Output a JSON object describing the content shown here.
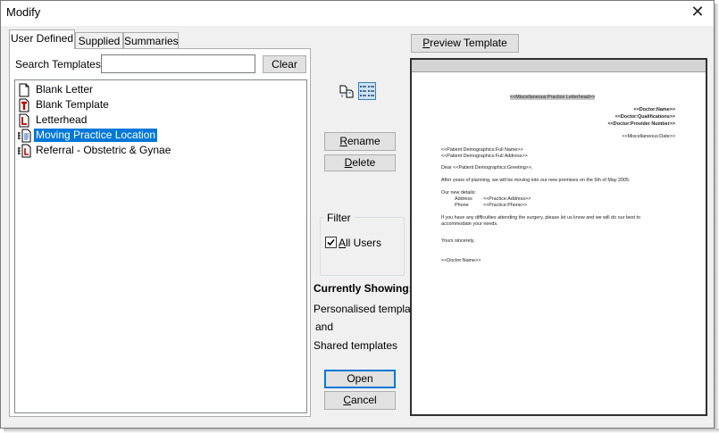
{
  "window": {
    "title": "Modify",
    "close_glyph": "✕"
  },
  "tabs": [
    {
      "label": "User Defined",
      "active": true
    },
    {
      "label": "Supplied",
      "active": false
    },
    {
      "label": "Summaries",
      "active": false
    }
  ],
  "search": {
    "label": "Search Templates:",
    "value": "",
    "clear_label": "Clear"
  },
  "templates": [
    {
      "label": "Blank Letter",
      "icon": "blank-document-icon",
      "selected": false
    },
    {
      "label": "Blank Template",
      "icon": "template-t-icon",
      "selected": false
    },
    {
      "label": "Letterhead",
      "icon": "letterhead-l-icon",
      "selected": false
    },
    {
      "label": "Moving Practice Location",
      "icon": "shared-document-icon",
      "selected": true
    },
    {
      "label": "Referral - Obstetric & Gynae",
      "icon": "shared-document-icon",
      "selected": false
    }
  ],
  "toolbar": {
    "small_icons": "small-icons-view-icon",
    "list_view": "list-view-icon"
  },
  "actions": {
    "rename_prefix": "R",
    "rename_rest": "ename",
    "delete_prefix": "D",
    "delete_rest": "elete",
    "open_label": "Open",
    "cancel_prefix": "C",
    "cancel_rest": "ancel"
  },
  "filter": {
    "title": "Filter",
    "all_users_prefix": "A",
    "all_users_rest": "ll Users",
    "all_users_checked": true
  },
  "showing": {
    "heading": "Currently Showing:",
    "line1": "Personalised templates",
    "line2": "and",
    "line3": "Shared templates"
  },
  "preview": {
    "button_prefix": "P",
    "button_rest": "review Template",
    "doc": {
      "letterhead": "<<Miscellaneous:Practice Letterhead>>",
      "doctor_name": "<<Doctor:Name>>",
      "doctor_quals": "<<Doctor:Qualifications>>",
      "provider_number": "<<Doctor:Provider Number>>",
      "date": "<<Miscellaneous:Date>>",
      "patient_name": "<<Patient Demographics:Full Name>>",
      "patient_address": "<<Patient Demographics:Full Address>>",
      "greeting": "Dear <<Patient Demographics:Greeting>>,",
      "para1": "After years of planning, we will be moving into our new premises on the 5th of May 2005.",
      "new_details": "Our new details:",
      "address_label": "Address",
      "address_value": "<<Practice:Address>>",
      "phone_label": "Phone",
      "phone_value": "<<Practice:Phone>>",
      "para2a": "If you have any difficulties attending the surgery, please let us know and we will do our best to",
      "para2b": "accommodate your needs.",
      "closing": "Yours sincerely,",
      "signature": "<<Doctor:Name>>"
    }
  }
}
